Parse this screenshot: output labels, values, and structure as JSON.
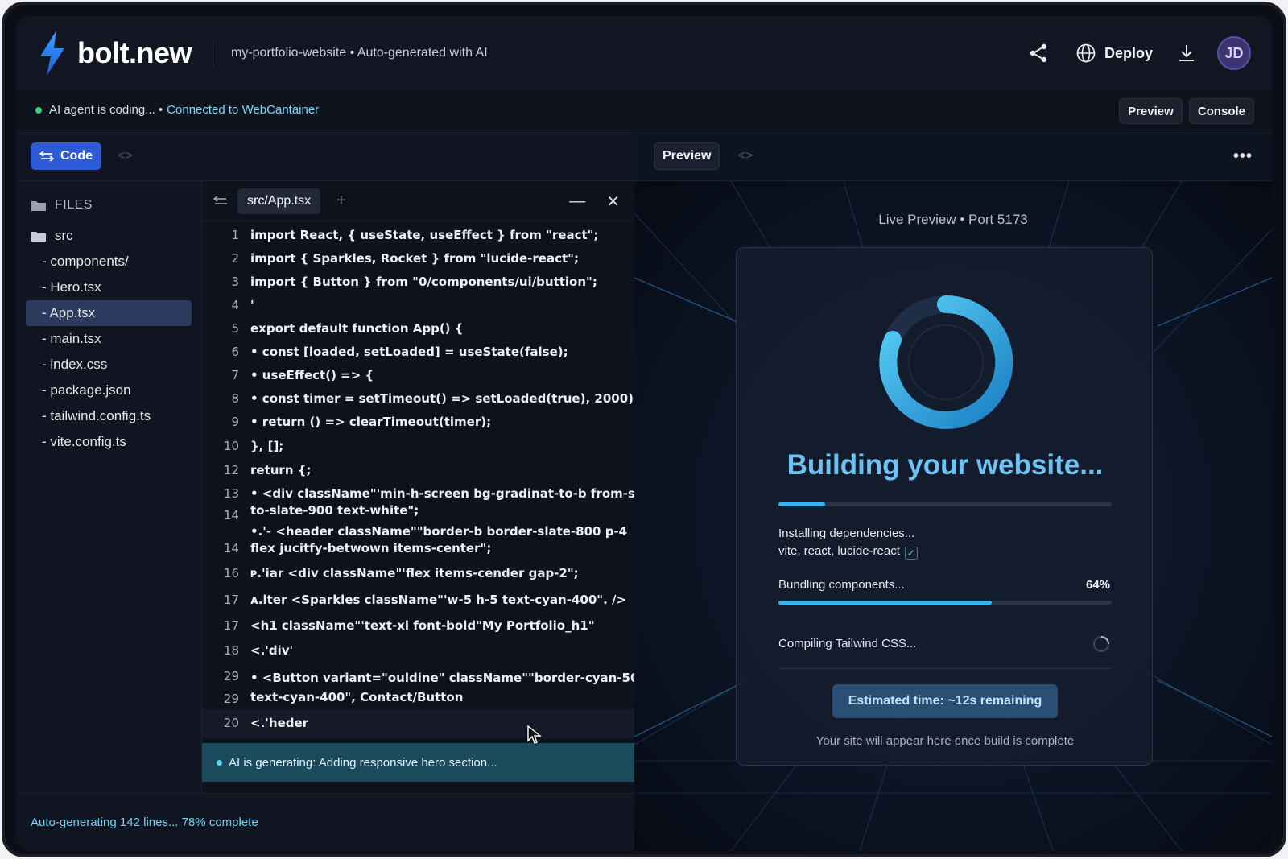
{
  "header": {
    "logo_text": "bolt.new",
    "project": "my-portfolio-website • Auto-generated with AI",
    "deploy_label": "Deploy",
    "avatar_initials": "JD"
  },
  "status": {
    "agent_text": "AI agent is coding... •",
    "connection_text": "Connected to WebCantainer",
    "buttons": [
      "Preview",
      "Console"
    ]
  },
  "left_panel": {
    "code_button": "Code",
    "files_header": "FILES",
    "folder": "src",
    "files": [
      "- components/",
      "- Hero.tsx",
      "- App.tsx",
      "- main.tsx",
      "- index.css",
      "- package.json",
      "- tailwind.config.ts",
      "- vite.config.ts"
    ],
    "active_file_index": 2
  },
  "editor": {
    "tab_label": "src/App.tsx",
    "lines": [
      {
        "n": "1",
        "code": "import React, { useState, useEffect } from \"react\";"
      },
      {
        "n": "2",
        "code": "import { Sparkles, Rocket } from \"lucide-react\";"
      },
      {
        "n": "3",
        "code": "import { Button } from \"0/components/ui/buttion\";"
      },
      {
        "n": "4",
        "code": "'"
      },
      {
        "n": "5",
        "code": "export default function App() {"
      },
      {
        "n": "6",
        "code": "• const [loaded, setLoaded] = useState(false);"
      },
      {
        "n": "7",
        "code": "• useEffect() => {"
      },
      {
        "n": "8",
        "code": "• const timer = setTimeout() => setLoaded(true), 2000);"
      },
      {
        "n": "9",
        "code": "• return () => clearTimeout(timer);"
      },
      {
        "n": "10",
        "code": "}, [];"
      },
      {
        "n": "12",
        "code": "return {;"
      },
      {
        "n": "13",
        "code": "• <div className\"'min-h-screen bg-gradinat-to-b from-slate-950"
      },
      {
        "n": "14",
        "code": "to-slate-900 text-white\";"
      },
      {
        "n": "",
        "code": "•.'- <header className\"\"border-b border-slate-800 p-4"
      },
      {
        "n": "14",
        "code": "      flex jucitfy-betwown items-center\";"
      },
      {
        "n": "16",
        "code": "ᴩ.'iar <div className\"'flex items-cender gap-2\";"
      },
      {
        "n": "17",
        "code": "ᴀ.lter <Sparkles className\"'w-5 h-5 text-cyan-400\". />"
      },
      {
        "n": "17",
        "code": "      <h1 className\"'text-xl font-bold\"My Portfolio_h1\""
      },
      {
        "n": "18",
        "code": "<.'div'"
      },
      {
        "n": "29",
        "code": "• <Button variant=\"ouldine\" className\"\"border-cyan-500"
      },
      {
        "n": "29",
        "code": "text-cyan-400\", Contact/Button"
      },
      {
        "n": "20",
        "code": "<.'heder"
      }
    ],
    "generating_text": "AI is generating: Adding responsive hero section..."
  },
  "footer": {
    "progress_text": "Auto-generating 142 lines...  78% complete"
  },
  "preview": {
    "button": "Preview",
    "live_label": "Live Preview • Port 5173",
    "title": "Building your website...",
    "top_progress": 0.14,
    "step1_title": "Installing dependencies...",
    "step1_detail": "vite, react, lucide-react",
    "step2_title": "Bundling components...",
    "step2_percent": "64%",
    "step2_progress": 0.64,
    "step3_title": "Compiling Tailwind CSS...",
    "eta": "Estimated time: ~12s remaining",
    "footnote": "Your site will appear here once build is complete"
  },
  "colors": {
    "accent": "#3cb3e8",
    "code_button": "#2d5bd6",
    "status_green": "#34d27a"
  }
}
